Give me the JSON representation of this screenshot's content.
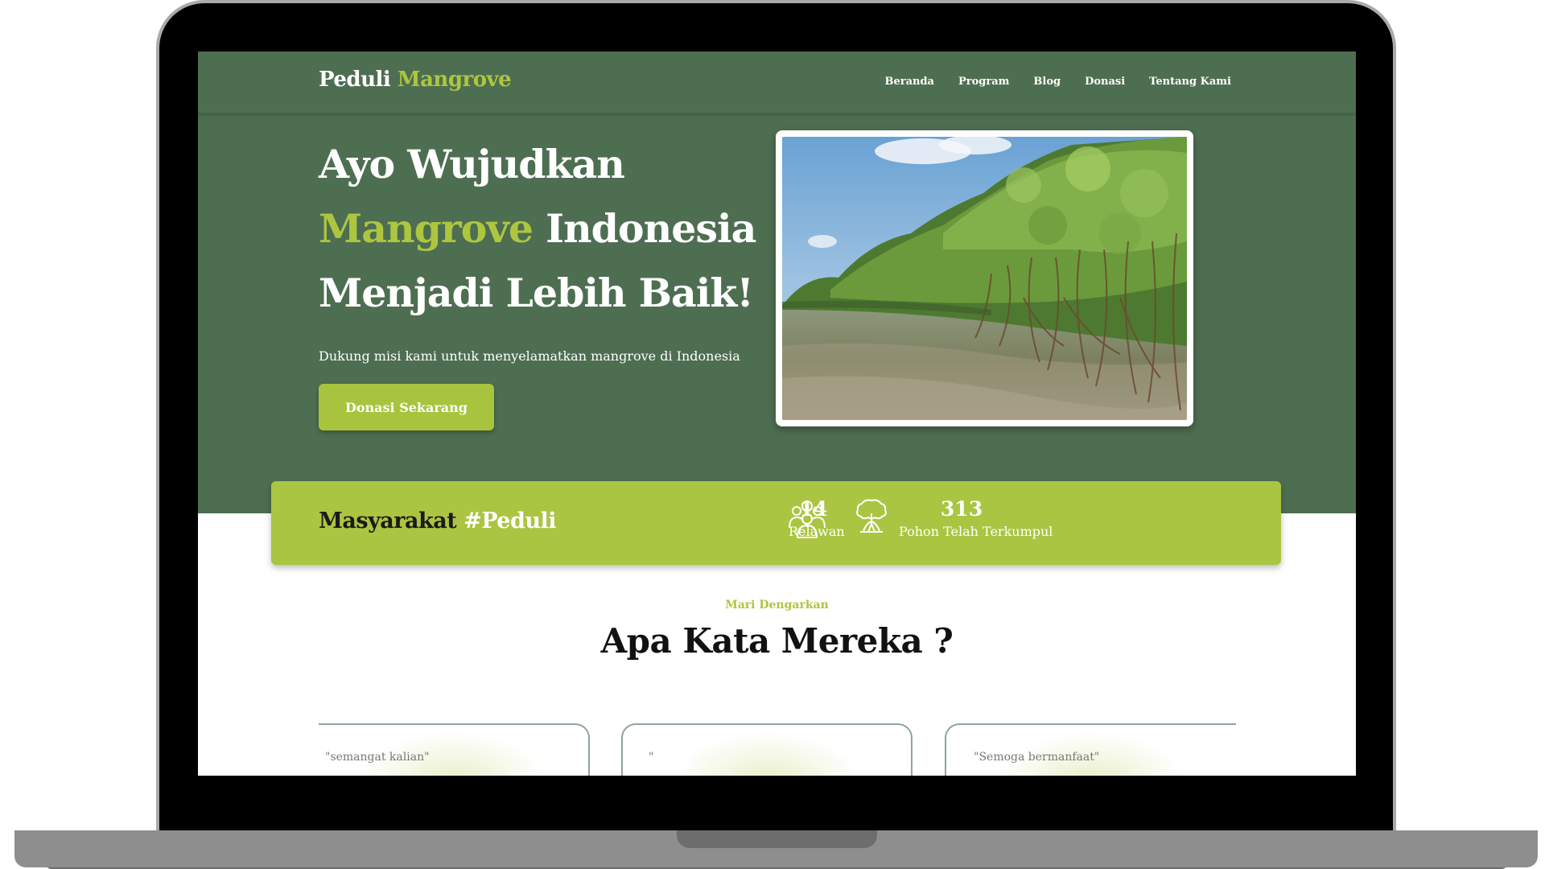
{
  "brand": {
    "name_first": "Peduli",
    "name_second": "Mangrove"
  },
  "nav": {
    "items": [
      "Beranda",
      "Program",
      "Blog",
      "Donasi",
      "Tentang Kami"
    ]
  },
  "hero": {
    "title_line1": "Ayo Wujudkan",
    "title_accent": "Mangrove",
    "title_line2_rest": " Indonesia",
    "title_line3": "Menjadi Lebih Baik!",
    "subtitle": "Dukung misi kami untuk menyelamatkan mangrove di Indonesia",
    "cta_label": "Donasi Sekarang"
  },
  "community": {
    "title": "Masyarakat",
    "title_hash": "#Peduli",
    "stats": [
      {
        "value": "14",
        "label": "Relawan",
        "icon": "people-group-icon"
      },
      {
        "value": "313",
        "label": "Pohon Telah Terkumpul",
        "icon": "mangrove-tree-icon"
      }
    ]
  },
  "testimonials": {
    "eyebrow": "Mari Dengarkan",
    "title": "Apa Kata Mereka ?",
    "items": [
      {
        "quote": "\"semangat kalian\""
      },
      {
        "quote": "\""
      },
      {
        "quote": "\"Semoga bermanfaat\""
      }
    ]
  },
  "colors": {
    "hero_green": "#4e6e52",
    "accent_lime": "#adc63f",
    "banner_lime": "#aac541"
  }
}
